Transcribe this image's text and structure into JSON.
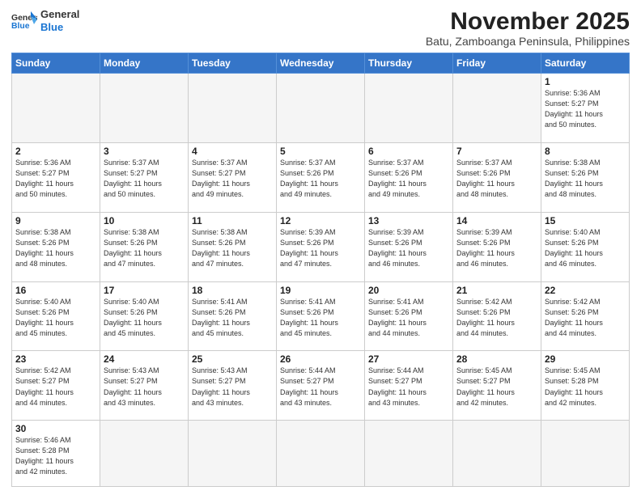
{
  "header": {
    "logo_general": "General",
    "logo_blue": "Blue",
    "month": "November 2025",
    "location": "Batu, Zamboanga Peninsula, Philippines"
  },
  "weekdays": [
    "Sunday",
    "Monday",
    "Tuesday",
    "Wednesday",
    "Thursday",
    "Friday",
    "Saturday"
  ],
  "rows": [
    [
      {
        "day": "",
        "info": ""
      },
      {
        "day": "",
        "info": ""
      },
      {
        "day": "",
        "info": ""
      },
      {
        "day": "",
        "info": ""
      },
      {
        "day": "",
        "info": ""
      },
      {
        "day": "",
        "info": ""
      },
      {
        "day": "1",
        "info": "Sunrise: 5:36 AM\nSunset: 5:27 PM\nDaylight: 11 hours\nand 50 minutes."
      }
    ],
    [
      {
        "day": "2",
        "info": "Sunrise: 5:36 AM\nSunset: 5:27 PM\nDaylight: 11 hours\nand 50 minutes."
      },
      {
        "day": "3",
        "info": "Sunrise: 5:37 AM\nSunset: 5:27 PM\nDaylight: 11 hours\nand 50 minutes."
      },
      {
        "day": "4",
        "info": "Sunrise: 5:37 AM\nSunset: 5:27 PM\nDaylight: 11 hours\nand 49 minutes."
      },
      {
        "day": "5",
        "info": "Sunrise: 5:37 AM\nSunset: 5:26 PM\nDaylight: 11 hours\nand 49 minutes."
      },
      {
        "day": "6",
        "info": "Sunrise: 5:37 AM\nSunset: 5:26 PM\nDaylight: 11 hours\nand 49 minutes."
      },
      {
        "day": "7",
        "info": "Sunrise: 5:37 AM\nSunset: 5:26 PM\nDaylight: 11 hours\nand 48 minutes."
      },
      {
        "day": "8",
        "info": "Sunrise: 5:38 AM\nSunset: 5:26 PM\nDaylight: 11 hours\nand 48 minutes."
      }
    ],
    [
      {
        "day": "9",
        "info": "Sunrise: 5:38 AM\nSunset: 5:26 PM\nDaylight: 11 hours\nand 48 minutes."
      },
      {
        "day": "10",
        "info": "Sunrise: 5:38 AM\nSunset: 5:26 PM\nDaylight: 11 hours\nand 47 minutes."
      },
      {
        "day": "11",
        "info": "Sunrise: 5:38 AM\nSunset: 5:26 PM\nDaylight: 11 hours\nand 47 minutes."
      },
      {
        "day": "12",
        "info": "Sunrise: 5:39 AM\nSunset: 5:26 PM\nDaylight: 11 hours\nand 47 minutes."
      },
      {
        "day": "13",
        "info": "Sunrise: 5:39 AM\nSunset: 5:26 PM\nDaylight: 11 hours\nand 46 minutes."
      },
      {
        "day": "14",
        "info": "Sunrise: 5:39 AM\nSunset: 5:26 PM\nDaylight: 11 hours\nand 46 minutes."
      },
      {
        "day": "15",
        "info": "Sunrise: 5:40 AM\nSunset: 5:26 PM\nDaylight: 11 hours\nand 46 minutes."
      }
    ],
    [
      {
        "day": "16",
        "info": "Sunrise: 5:40 AM\nSunset: 5:26 PM\nDaylight: 11 hours\nand 45 minutes."
      },
      {
        "day": "17",
        "info": "Sunrise: 5:40 AM\nSunset: 5:26 PM\nDaylight: 11 hours\nand 45 minutes."
      },
      {
        "day": "18",
        "info": "Sunrise: 5:41 AM\nSunset: 5:26 PM\nDaylight: 11 hours\nand 45 minutes."
      },
      {
        "day": "19",
        "info": "Sunrise: 5:41 AM\nSunset: 5:26 PM\nDaylight: 11 hours\nand 45 minutes."
      },
      {
        "day": "20",
        "info": "Sunrise: 5:41 AM\nSunset: 5:26 PM\nDaylight: 11 hours\nand 44 minutes."
      },
      {
        "day": "21",
        "info": "Sunrise: 5:42 AM\nSunset: 5:26 PM\nDaylight: 11 hours\nand 44 minutes."
      },
      {
        "day": "22",
        "info": "Sunrise: 5:42 AM\nSunset: 5:26 PM\nDaylight: 11 hours\nand 44 minutes."
      }
    ],
    [
      {
        "day": "23",
        "info": "Sunrise: 5:42 AM\nSunset: 5:27 PM\nDaylight: 11 hours\nand 44 minutes."
      },
      {
        "day": "24",
        "info": "Sunrise: 5:43 AM\nSunset: 5:27 PM\nDaylight: 11 hours\nand 43 minutes."
      },
      {
        "day": "25",
        "info": "Sunrise: 5:43 AM\nSunset: 5:27 PM\nDaylight: 11 hours\nand 43 minutes."
      },
      {
        "day": "26",
        "info": "Sunrise: 5:44 AM\nSunset: 5:27 PM\nDaylight: 11 hours\nand 43 minutes."
      },
      {
        "day": "27",
        "info": "Sunrise: 5:44 AM\nSunset: 5:27 PM\nDaylight: 11 hours\nand 43 minutes."
      },
      {
        "day": "28",
        "info": "Sunrise: 5:45 AM\nSunset: 5:27 PM\nDaylight: 11 hours\nand 42 minutes."
      },
      {
        "day": "29",
        "info": "Sunrise: 5:45 AM\nSunset: 5:28 PM\nDaylight: 11 hours\nand 42 minutes."
      }
    ],
    [
      {
        "day": "30",
        "info": "Sunrise: 5:46 AM\nSunset: 5:28 PM\nDaylight: 11 hours\nand 42 minutes."
      },
      {
        "day": "",
        "info": ""
      },
      {
        "day": "",
        "info": ""
      },
      {
        "day": "",
        "info": ""
      },
      {
        "day": "",
        "info": ""
      },
      {
        "day": "",
        "info": ""
      },
      {
        "day": "",
        "info": ""
      }
    ]
  ]
}
